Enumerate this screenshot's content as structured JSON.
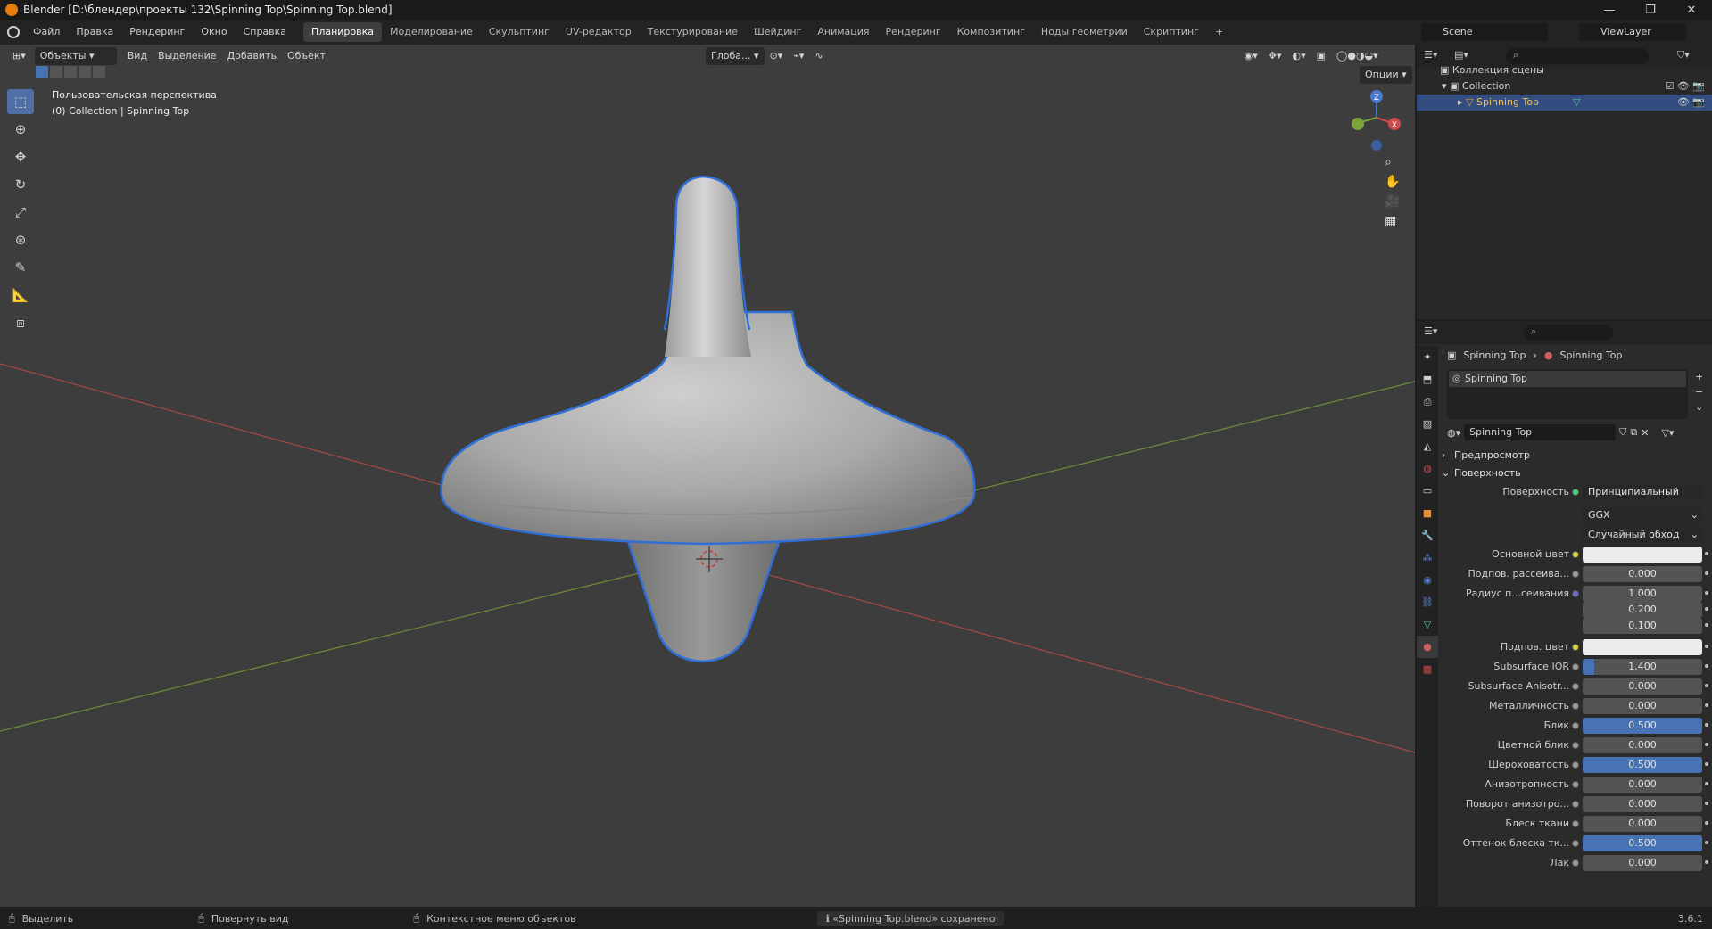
{
  "titlebar": {
    "title": "Blender [D:\\блендер\\проекты 132\\Spinning Top\\Spinning Top.blend]",
    "minimize": "—",
    "maximize": "❐",
    "close": "✕"
  },
  "menu": {
    "items": [
      "Файл",
      "Правка",
      "Рендеринг",
      "Окно",
      "Справка"
    ]
  },
  "workspaces": {
    "tabs": [
      "Планировка",
      "Моделирование",
      "Скульптинг",
      "UV-редактор",
      "Текстурирование",
      "Шейдинг",
      "Анимация",
      "Рендеринг",
      "Композитинг",
      "Ноды геометрии",
      "Скриптинг"
    ],
    "active": "Планировка",
    "add": "+"
  },
  "scene": {
    "name": "Scene",
    "view_layer": "ViewLayer"
  },
  "viewport": {
    "mode": "Объекты",
    "menus": [
      "Вид",
      "Выделение",
      "Добавить",
      "Объект"
    ],
    "orientation": "Глоба...",
    "options": "Опции",
    "perspective": "Пользовательская перспектива",
    "collection_info": "(0) Collection | Spinning Top",
    "gizmo_axes": {
      "x": "X",
      "y": "Y",
      "z": "Z"
    }
  },
  "outliner": {
    "scene_collection": "Коллекция сцены",
    "collection": "Collection",
    "object": "Spinning Top"
  },
  "properties": {
    "breadcrumb_object": "Spinning Top",
    "breadcrumb_material": "Spinning Top",
    "material_slot": "Spinning Top",
    "material_name": "Spinning Top",
    "sections": {
      "preview": "Предпросмотр",
      "surface": "Поверхность"
    },
    "surface_shader_label": "Поверхность",
    "surface_shader": "Принципиальный BSDF",
    "distribution": "GGX",
    "subsurface_method": "Случайный обход",
    "params": [
      {
        "label": "Основной цвет",
        "value": "",
        "type": "color",
        "color": "#ececec",
        "dot": "#d6d43a"
      },
      {
        "label": "Подпов. рассеива...",
        "value": "0.000",
        "type": "num",
        "fill": 0
      },
      {
        "label": "Радиус п...сеивания",
        "value": "1.000",
        "type": "num",
        "fill": 0,
        "dot": "#6a6ac8"
      },
      {
        "label": "",
        "value": "0.200",
        "type": "num",
        "fill": 0,
        "nodot": true
      },
      {
        "label": "",
        "value": "0.100",
        "type": "num",
        "fill": 0,
        "nodot": true
      },
      {
        "label": "Подпов. цвет",
        "value": "",
        "type": "color",
        "color": "#ececec",
        "dot": "#d6d43a"
      },
      {
        "label": "Subsurface IOR",
        "value": "1.400",
        "type": "num",
        "fill": 0.1
      },
      {
        "label": "Subsurface Anisotr...",
        "value": "0.000",
        "type": "num",
        "fill": 0
      },
      {
        "label": "Металличность",
        "value": "0.000",
        "type": "num",
        "fill": 0
      },
      {
        "label": "Блик",
        "value": "0.500",
        "type": "num",
        "fill": 1
      },
      {
        "label": "Цветной блик",
        "value": "0.000",
        "type": "num",
        "fill": 0
      },
      {
        "label": "Шероховатость",
        "value": "0.500",
        "type": "num",
        "fill": 1
      },
      {
        "label": "Анизотропность",
        "value": "0.000",
        "type": "num",
        "fill": 0
      },
      {
        "label": "Поворот анизотро...",
        "value": "0.000",
        "type": "num",
        "fill": 0
      },
      {
        "label": "Блеск ткани",
        "value": "0.000",
        "type": "num",
        "fill": 0
      },
      {
        "label": "Оттенок блеска тк...",
        "value": "0.500",
        "type": "num",
        "fill": 1
      },
      {
        "label": "Лак",
        "value": "0.000",
        "type": "num",
        "fill": 0
      }
    ]
  },
  "statusbar": {
    "select": "Выделить",
    "rotate": "Повернуть вид",
    "context_menu": "Контекстное меню объектов",
    "message": "«Spinning Top.blend» сохранено",
    "version": "3.6.1"
  },
  "colors": {
    "accent": "#4772b3",
    "selection_outline": "#2f6fd6",
    "x_axis": "#c84a4a",
    "y_axis": "#7aa33c"
  }
}
